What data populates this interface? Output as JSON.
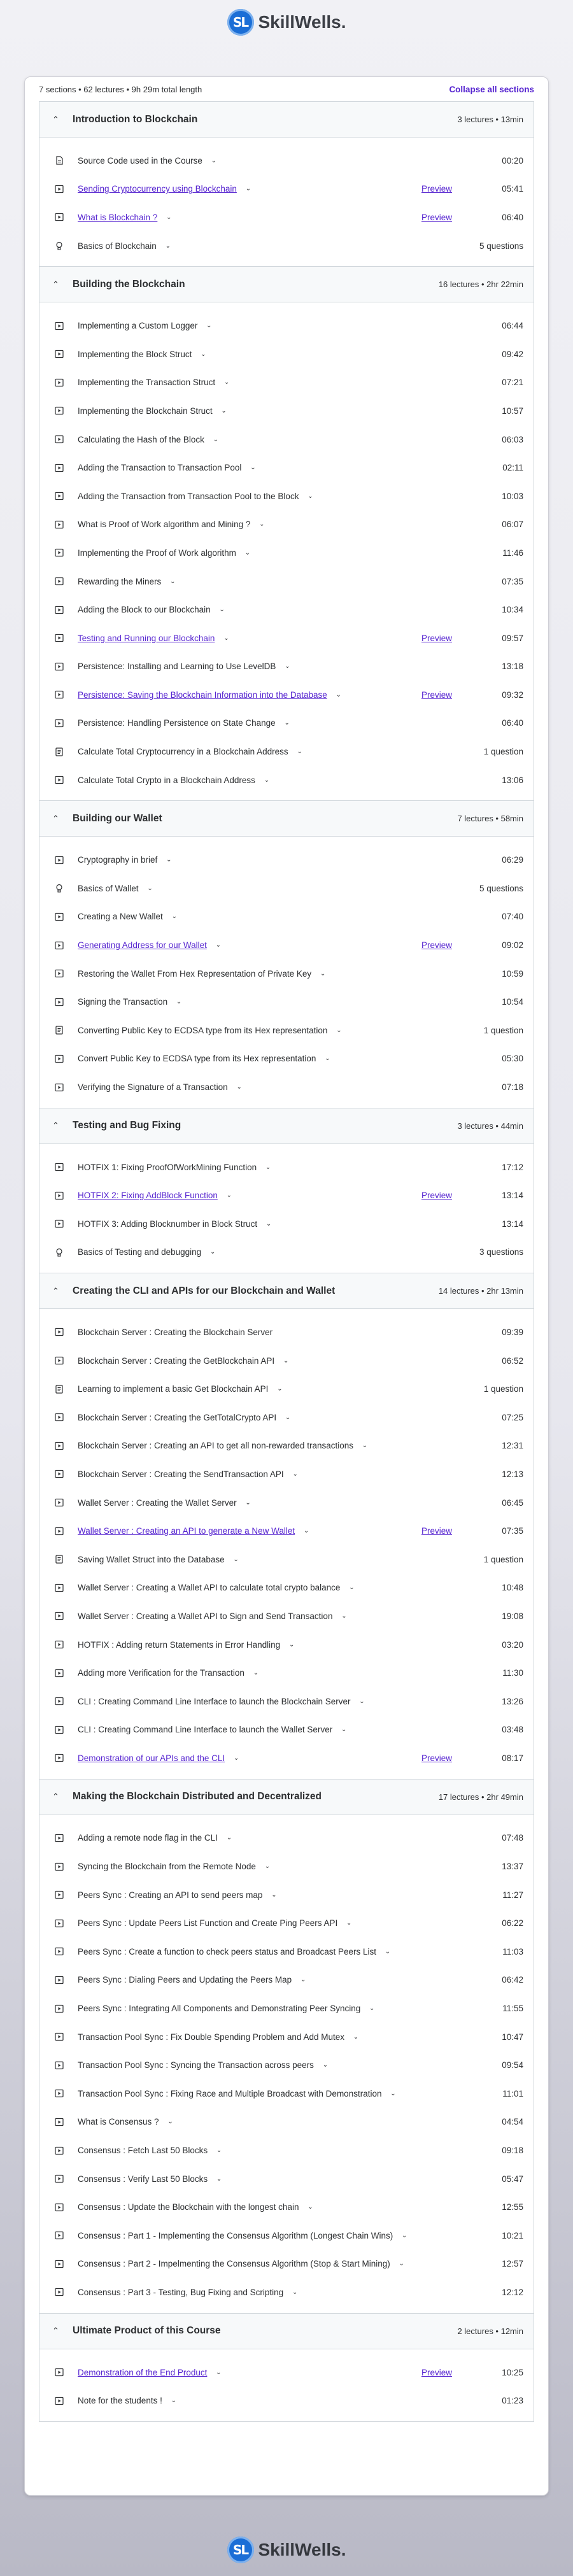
{
  "brand": {
    "name": "SkillWells.",
    "mark": "SL"
  },
  "summary": {
    "text": "7 sections • 62 lectures • 9h 29m total length",
    "collapse_label": "Collapse all sections"
  },
  "sections": [
    {
      "title": "Introduction to Blockchain",
      "meta": "3 lectures • 13min",
      "lectures": [
        {
          "icon": "file",
          "title": "Source Code used in the Course",
          "duration": "00:20"
        },
        {
          "icon": "video",
          "title": "Sending Cryptocurrency using Blockchain",
          "link": true,
          "preview": "Preview",
          "duration": "05:41"
        },
        {
          "icon": "video",
          "title": "What is Blockchain ?",
          "link": true,
          "preview": "Preview",
          "duration": "06:40"
        },
        {
          "icon": "bulb",
          "title": "Basics of Blockchain",
          "duration": "5 questions"
        }
      ]
    },
    {
      "title": "Building the Blockchain",
      "meta": "16 lectures • 2hr 22min",
      "lectures": [
        {
          "icon": "video",
          "title": "Implementing a Custom Logger",
          "duration": "06:44"
        },
        {
          "icon": "video",
          "title": "Implementing the Block Struct",
          "duration": "09:42"
        },
        {
          "icon": "video",
          "title": "Implementing the Transaction Struct",
          "duration": "07:21"
        },
        {
          "icon": "video",
          "title": "Implementing the Blockchain Struct",
          "duration": "10:57"
        },
        {
          "icon": "video",
          "title": "Calculating the Hash of the Block",
          "duration": "06:03"
        },
        {
          "icon": "video",
          "title": "Adding the Transaction to Transaction Pool",
          "duration": "02:11"
        },
        {
          "icon": "video",
          "title": "Adding the Transaction from Transaction Pool to the Block",
          "duration": "10:03"
        },
        {
          "icon": "video",
          "title": "What is Proof of Work algorithm and Mining ?",
          "duration": "06:07"
        },
        {
          "icon": "video",
          "title": "Implementing the Proof of Work algorithm",
          "duration": "11:46"
        },
        {
          "icon": "video",
          "title": "Rewarding the Miners",
          "duration": "07:35"
        },
        {
          "icon": "video",
          "title": "Adding the Block to our Blockchain",
          "duration": "10:34"
        },
        {
          "icon": "video",
          "title": "Testing and Running our Blockchain",
          "link": true,
          "preview": "Preview",
          "duration": "09:57"
        },
        {
          "icon": "video",
          "title": "Persistence: Installing and Learning to Use LevelDB",
          "duration": "13:18"
        },
        {
          "icon": "video",
          "title": "Persistence: Saving the Blockchain Information into the Database",
          "link": true,
          "preview": "Preview",
          "duration": "09:32"
        },
        {
          "icon": "video",
          "title": "Persistence: Handling Persistence on State Change",
          "duration": "06:40"
        },
        {
          "icon": "quiz",
          "title": "Calculate Total Cryptocurrency in a Blockchain Address",
          "duration": "1 question"
        },
        {
          "icon": "video",
          "title": "Calculate Total Crypto in a Blockchain Address",
          "duration": "13:06"
        }
      ]
    },
    {
      "title": "Building our Wallet",
      "meta": "7 lectures • 58min",
      "lectures": [
        {
          "icon": "video",
          "title": "Cryptography in brief",
          "duration": "06:29"
        },
        {
          "icon": "bulb",
          "title": "Basics of Wallet",
          "duration": "5 questions"
        },
        {
          "icon": "video",
          "title": "Creating a New Wallet",
          "duration": "07:40"
        },
        {
          "icon": "video",
          "title": "Generating Address for our Wallet",
          "link": true,
          "preview": "Preview",
          "duration": "09:02"
        },
        {
          "icon": "video",
          "title": "Restoring the Wallet From Hex Representation of Private Key",
          "duration": "10:59"
        },
        {
          "icon": "video",
          "title": "Signing the Transaction",
          "duration": "10:54"
        },
        {
          "icon": "quiz",
          "title": "Converting Public Key to ECDSA type from its Hex representation",
          "duration": "1 question"
        },
        {
          "icon": "video",
          "title": "Convert Public Key to ECDSA type from its Hex representation",
          "duration": "05:30"
        },
        {
          "icon": "video",
          "title": "Verifying the Signature of a Transaction",
          "duration": "07:18"
        }
      ]
    },
    {
      "title": "Testing and Bug Fixing",
      "meta": "3 lectures • 44min",
      "lectures": [
        {
          "icon": "video",
          "title": "HOTFIX 1: Fixing ProofOfWorkMining Function",
          "duration": "17:12"
        },
        {
          "icon": "video",
          "title": "HOTFIX 2: Fixing AddBlock Function",
          "link": true,
          "preview": "Preview",
          "duration": "13:14"
        },
        {
          "icon": "video",
          "title": "HOTFIX 3: Adding Blocknumber in Block Struct",
          "duration": "13:14"
        },
        {
          "icon": "bulb",
          "title": "Basics of Testing and debugging",
          "duration": "3 questions"
        }
      ]
    },
    {
      "title": "Creating the CLI and APIs for our Blockchain and Wallet",
      "meta": "14 lectures • 2hr 13min",
      "lectures": [
        {
          "icon": "video",
          "title": "Blockchain Server : Creating the Blockchain Server",
          "chev": false,
          "duration": "09:39"
        },
        {
          "icon": "video",
          "title": "Blockchain Server : Creating the GetBlockchain API",
          "duration": "06:52"
        },
        {
          "icon": "quiz",
          "title": "Learning to implement a basic Get Blockchain API",
          "duration": "1 question"
        },
        {
          "icon": "video",
          "title": "Blockchain Server : Creating the GetTotalCrypto API",
          "duration": "07:25"
        },
        {
          "icon": "video",
          "title": "Blockchain Server : Creating an API to get all non-rewarded transactions",
          "duration": "12:31"
        },
        {
          "icon": "video",
          "title": "Blockchain Server : Creating the SendTransaction API",
          "duration": "12:13"
        },
        {
          "icon": "video",
          "title": "Wallet Server : Creating the Wallet Server",
          "duration": "06:45"
        },
        {
          "icon": "video",
          "title": "Wallet Server : Creating an API to generate a New Wallet",
          "link": true,
          "preview": "Preview",
          "duration": "07:35"
        },
        {
          "icon": "quiz",
          "title": "Saving Wallet Struct into the Database",
          "duration": "1 question"
        },
        {
          "icon": "video",
          "title": "Wallet Server : Creating a Wallet API to calculate total crypto balance",
          "duration": "10:48"
        },
        {
          "icon": "video",
          "title": "Wallet Server : Creating a Wallet API to Sign and Send Transaction",
          "duration": "19:08"
        },
        {
          "icon": "video",
          "title": "HOTFIX : Adding return Statements in Error Handling",
          "duration": "03:20"
        },
        {
          "icon": "video",
          "title": "Adding more Verification for the Transaction",
          "duration": "11:30"
        },
        {
          "icon": "video",
          "title": "CLI : Creating Command Line Interface to launch the Blockchain Server",
          "duration": "13:26"
        },
        {
          "icon": "video",
          "title": "CLI : Creating Command Line Interface to launch the Wallet Server",
          "duration": "03:48"
        },
        {
          "icon": "video",
          "title": "Demonstration of our APIs and the CLI",
          "link": true,
          "preview": "Preview",
          "duration": "08:17"
        }
      ]
    },
    {
      "title": "Making the Blockchain Distributed and Decentralized",
      "meta": "17 lectures • 2hr 49min",
      "lectures": [
        {
          "icon": "video",
          "title": "Adding a remote node flag in the CLI",
          "duration": "07:48"
        },
        {
          "icon": "video",
          "title": "Syncing the Blockchain from the Remote Node",
          "duration": "13:37"
        },
        {
          "icon": "video",
          "title": "Peers Sync : Creating an API to send peers map",
          "duration": "11:27"
        },
        {
          "icon": "video",
          "title": "Peers Sync : Update Peers List Function and Create Ping Peers API",
          "duration": "06:22"
        },
        {
          "icon": "video",
          "title": "Peers Sync : Create a function to check peers status and Broadcast Peers List",
          "duration": "11:03"
        },
        {
          "icon": "video",
          "title": "Peers Sync : Dialing Peers and Updating the Peers Map",
          "duration": "06:42"
        },
        {
          "icon": "video",
          "title": "Peers Sync : Integrating All Components and Demonstrating Peer Syncing",
          "duration": "11:55"
        },
        {
          "icon": "video",
          "title": "Transaction Pool Sync : Fix Double Spending Problem and Add Mutex",
          "duration": "10:47"
        },
        {
          "icon": "video",
          "title": "Transaction Pool Sync : Syncing the Transaction across peers",
          "duration": "09:54"
        },
        {
          "icon": "video",
          "title": "Transaction Pool Sync : Fixing Race and Multiple Broadcast with Demonstration",
          "duration": "11:01"
        },
        {
          "icon": "video",
          "title": "What is Consensus ?",
          "duration": "04:54"
        },
        {
          "icon": "video",
          "title": "Consensus : Fetch Last 50 Blocks",
          "duration": "09:18"
        },
        {
          "icon": "video",
          "title": "Consensus : Verify Last 50 Blocks",
          "duration": "05:47"
        },
        {
          "icon": "video",
          "title": "Consensus : Update the Blockchain with the longest chain",
          "duration": "12:55"
        },
        {
          "icon": "video",
          "title": "Consensus : Part 1 - Implementing the Consensus Algorithm (Longest Chain Wins)",
          "duration": "10:21"
        },
        {
          "icon": "video",
          "title": "Consensus : Part 2 - Impelmenting the Consensus Algorithm (Stop & Start Mining)",
          "duration": "12:57"
        },
        {
          "icon": "video",
          "title": "Consensus : Part 3 - Testing, Bug Fixing and Scripting",
          "duration": "12:12"
        }
      ]
    },
    {
      "title": "Ultimate Product of this Course",
      "meta": "2 lectures • 12min",
      "lectures": [
        {
          "icon": "video",
          "title": "Demonstration of the End Product",
          "link": true,
          "preview": "Preview",
          "duration": "10:25"
        },
        {
          "icon": "video",
          "title": "Note for the students !",
          "duration": "01:23"
        }
      ]
    }
  ]
}
